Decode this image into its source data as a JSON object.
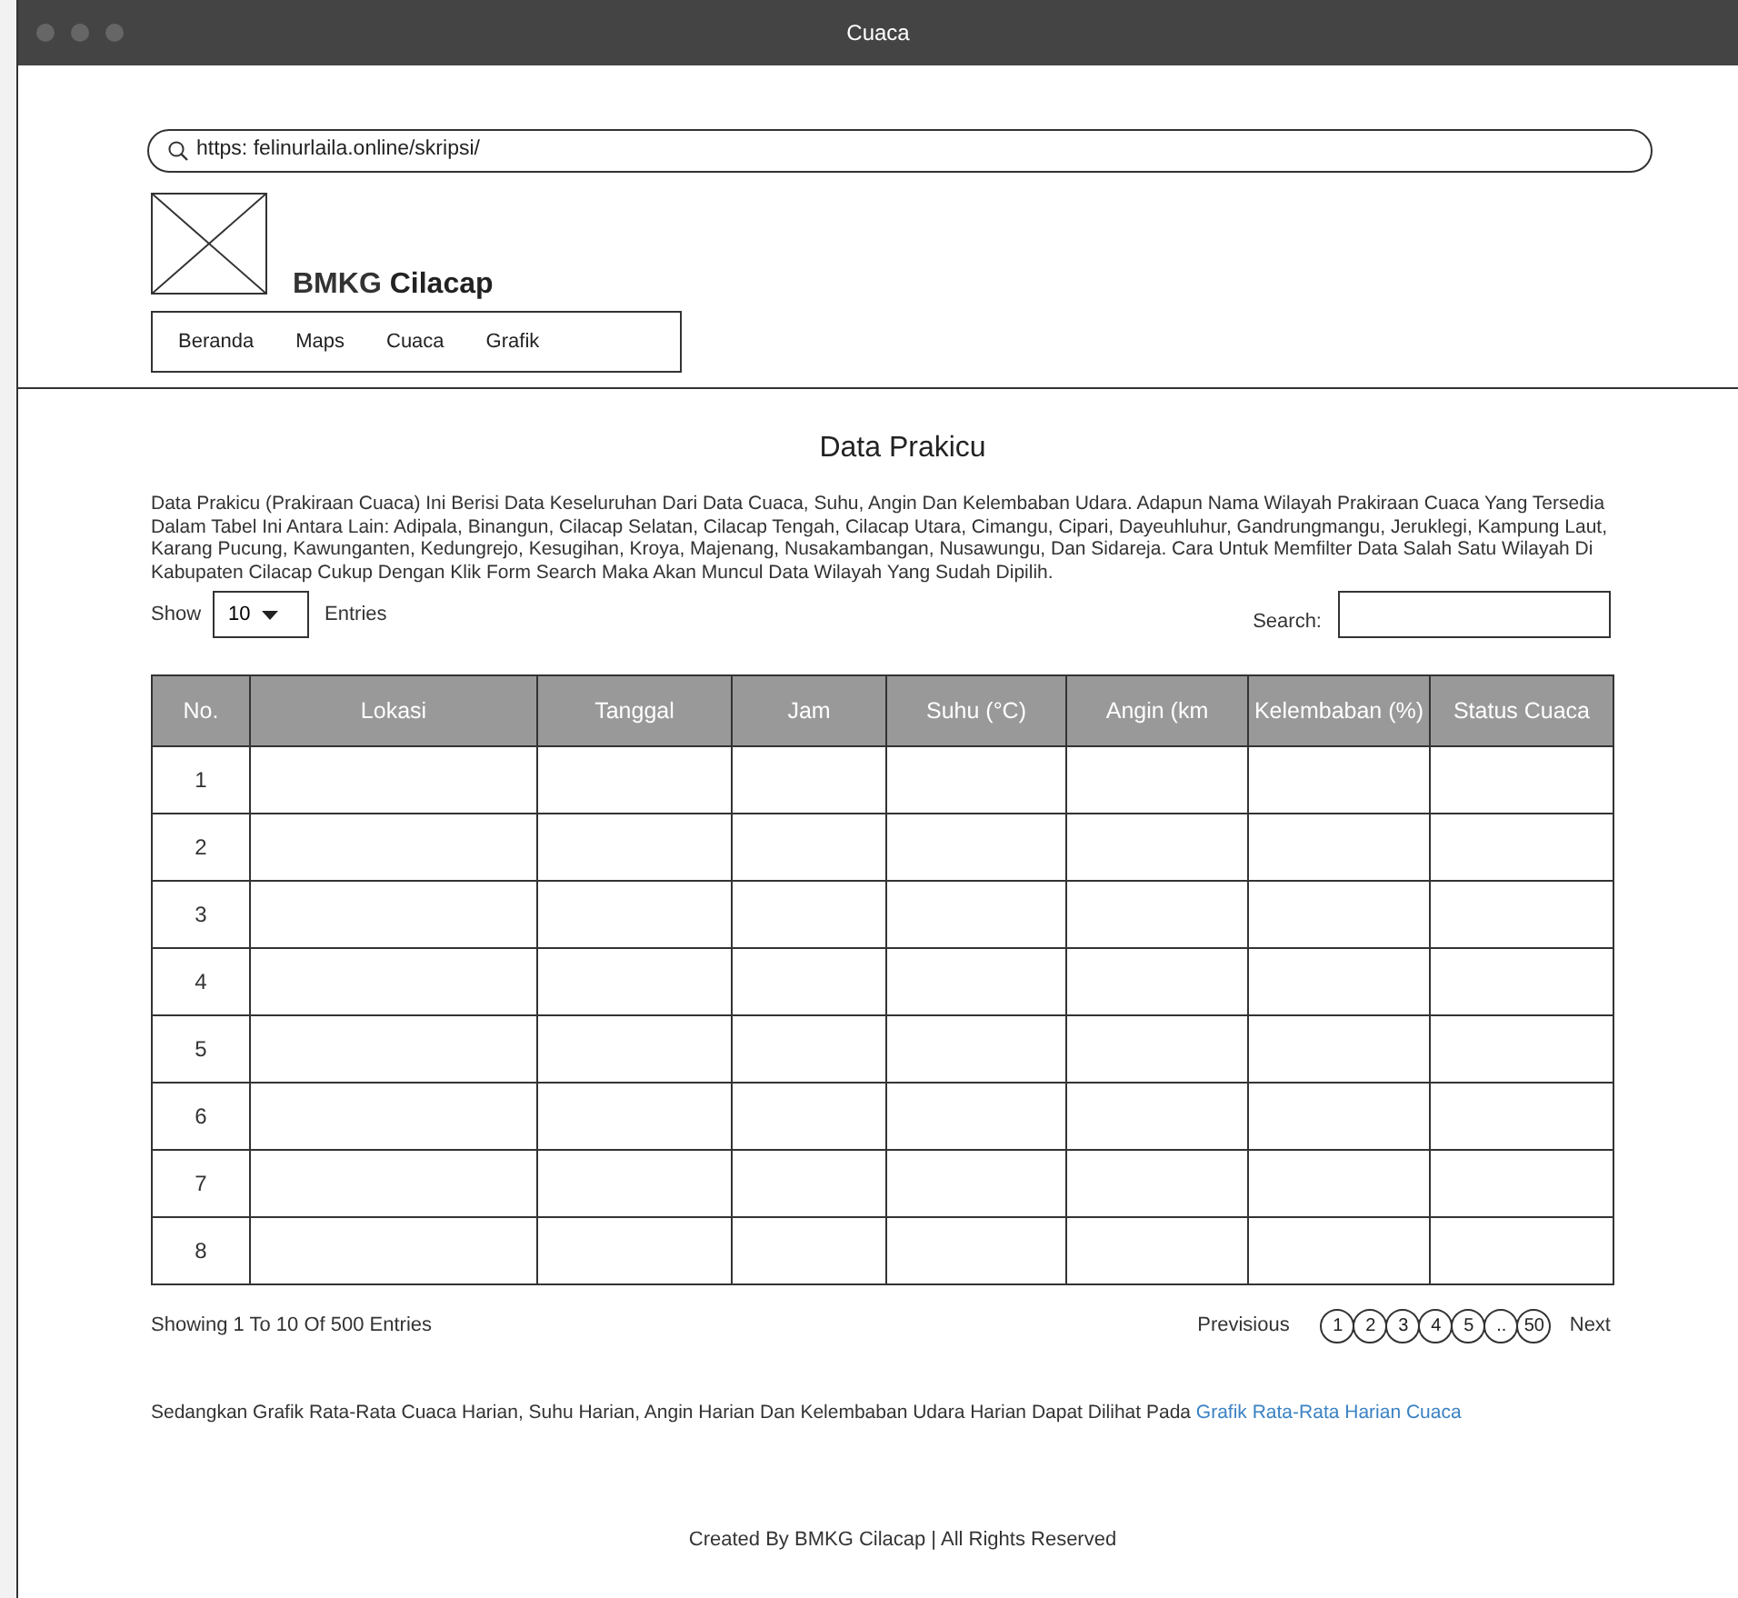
{
  "window": {
    "title": "Cuaca"
  },
  "address_bar": {
    "url": "https: felinurlaila.online/skripsi/"
  },
  "header": {
    "brand_prefix": "BMKG",
    "brand_name": "Cilacap",
    "nav": [
      "Beranda",
      "Maps",
      "Cuaca",
      "Grafik"
    ]
  },
  "main": {
    "heading": "Data Prakicu",
    "description": "Data Prakicu (Prakiraan Cuaca) Ini Berisi Data Keseluruhan Dari Data Cuaca, Suhu, Angin Dan Kelembaban Udara. Adapun Nama Wilayah Prakiraan Cuaca Yang Tersedia Dalam Tabel Ini Antara Lain: Adipala, Binangun, Cilacap Selatan, Cilacap Tengah, Cilacap Utara, Cimangu, Cipari, Dayeuhluhur, Gandrungmangu, Jeruklegi, Kampung Laut, Karang Pucung, Kawunganten, Kedungrejo, Kesugihan, Kroya, Majenang, Nusakambangan, Nusawungu, Dan Sidareja. Cara Untuk Memfilter Data Salah Satu Wilayah Di Kabupaten Cilacap Cukup Dengan Klik Form Search Maka Akan Muncul Data Wilayah Yang Sudah Dipilih.",
    "show_label": "Show",
    "entries_value": "10",
    "entries_label": "Entries",
    "search_label": "Search:"
  },
  "table": {
    "columns": [
      "No.",
      "Lokasi",
      "Tanggal",
      "Jam",
      "Suhu (°C)",
      "Angin (km",
      "Kelembaban (%)",
      "Status Cuaca"
    ],
    "rows": [
      {
        "no": "1"
      },
      {
        "no": "2"
      },
      {
        "no": "3"
      },
      {
        "no": "4"
      },
      {
        "no": "5"
      },
      {
        "no": "6"
      },
      {
        "no": "7"
      },
      {
        "no": "8"
      }
    ]
  },
  "pagination": {
    "info": "Showing 1 To 10 Of 500 Entries",
    "previous": "Previsious",
    "pages": [
      "1",
      "2",
      "3",
      "4",
      "5",
      "..",
      "50"
    ],
    "next": "Next"
  },
  "note": {
    "text": "Sedangkan Grafik Rata-Rata Cuaca Harian, Suhu Harian, Angin Harian Dan Kelembaban Udara Harian Dapat Dilihat Pada",
    "link": "Grafik Rata-Rata Harian Cuaca"
  },
  "footer": "Created By BMKG Cilacap | All Rights Reserved"
}
